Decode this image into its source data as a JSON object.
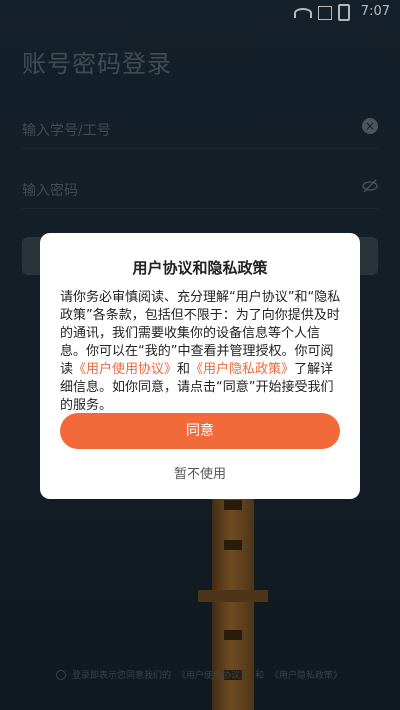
{
  "status_bar": {
    "time": "7:07"
  },
  "login": {
    "title": "账号密码登录",
    "account_placeholder": "输入学号/工号",
    "password_placeholder": "输入密码"
  },
  "consent": {
    "prefix": "登录即表示您同意我们的",
    "user_agreement": "《用户使用协议》",
    "and": "和",
    "privacy_policy": "《用户隐私政策》"
  },
  "dialog": {
    "title": "用户协议和隐私政策",
    "body_part1": "请你务必审慎阅读、充分理解“用户协议”和“隐私政策”各条款，包括但不限于：为了向你提供及时的通讯，我们需要收集你的设备信息等个人信息。你可以在“我的”中查看并管理授权。你可阅读",
    "link_user_agreement": "《用户使用协议》",
    "body_and": "和",
    "link_privacy_policy": "《用户隐私政策》",
    "body_part2": "了解详细信息。如你同意，请点击“同意”开始接受我们的服务。",
    "agree_label": "同意",
    "decline_label": "暂不使用"
  },
  "colors": {
    "accent": "#f26a3a",
    "link": "#f0673a",
    "background": "#1c2a36"
  }
}
